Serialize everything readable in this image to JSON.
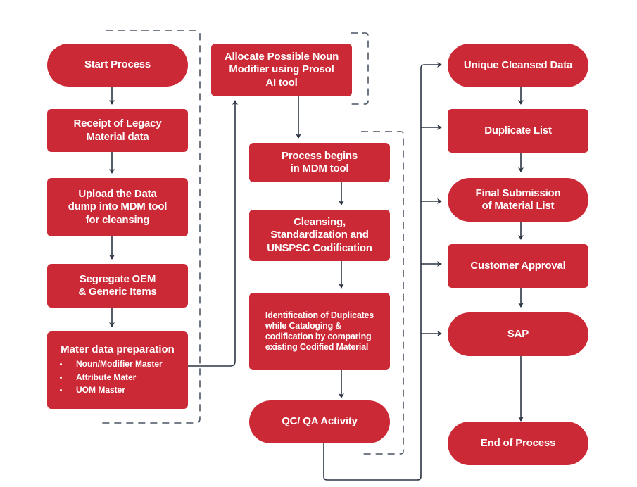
{
  "diagram": {
    "colors": {
      "node_fill": "#CC2936",
      "node_text": "#FFFFFF",
      "connector": "#2B3543",
      "dashed_bracket": "#4A5563"
    },
    "columns": {
      "left": {
        "nodes": [
          {
            "id": "start",
            "shape": "pill",
            "label": "Start Process"
          },
          {
            "id": "receipt",
            "shape": "rect",
            "label": "Receipt of Legacy\nMaterial  data"
          },
          {
            "id": "upload",
            "shape": "rect",
            "label": "Upload the Data\ndump into  MDM tool\nfor cleansing"
          },
          {
            "id": "segregate",
            "shape": "rect",
            "label": "Segregate OEM\n& Generic  Items"
          },
          {
            "id": "prep",
            "shape": "rect",
            "label": "Mater data preparation",
            "bullets": [
              "Noun/Modifier Master",
              "Attribute Mater",
              "UOM Master"
            ]
          }
        ]
      },
      "middle": {
        "nodes": [
          {
            "id": "allocate",
            "shape": "rect",
            "label": "Allocate Possible Noun\nModifier using Prosol\nAI tool"
          },
          {
            "id": "process_begins",
            "shape": "rect",
            "label": "Process begins\nin MDM tool"
          },
          {
            "id": "cleansing",
            "shape": "rect",
            "label": "Cleansing,\nStandardization and\nUNSPSC Codification"
          },
          {
            "id": "identification",
            "shape": "rect",
            "label": "Identification of Duplicates\nwhile Cataloging &\ncodification by comparing\nexisting Codified  Material"
          },
          {
            "id": "qcqa",
            "shape": "pill",
            "label": "QC/ QA Activity"
          }
        ]
      },
      "right": {
        "nodes": [
          {
            "id": "unique",
            "shape": "pill",
            "label": "Unique Cleansed Data"
          },
          {
            "id": "duplicate",
            "shape": "rect",
            "label": "Duplicate List"
          },
          {
            "id": "final",
            "shape": "pill",
            "label": "Final Submission\nof  Material List"
          },
          {
            "id": "approval",
            "shape": "rect",
            "label": "Customer Approval"
          },
          {
            "id": "sap",
            "shape": "pill",
            "label": "SAP"
          },
          {
            "id": "end",
            "shape": "pill",
            "label": "End of Process"
          }
        ]
      }
    },
    "edges": [
      {
        "from": "start",
        "to": "receipt"
      },
      {
        "from": "receipt",
        "to": "upload"
      },
      {
        "from": "upload",
        "to": "segregate"
      },
      {
        "from": "segregate",
        "to": "prep"
      },
      {
        "from": "prep",
        "to": "allocate"
      },
      {
        "from": "allocate",
        "to": "process_begins"
      },
      {
        "from": "process_begins",
        "to": "cleansing"
      },
      {
        "from": "cleansing",
        "to": "identification"
      },
      {
        "from": "identification",
        "to": "qcqa"
      },
      {
        "from": "qcqa",
        "to": "unique"
      },
      {
        "from": "qcqa",
        "to": "duplicate"
      },
      {
        "from": "qcqa",
        "to": "final"
      },
      {
        "from": "qcqa",
        "to": "approval"
      },
      {
        "from": "qcqa",
        "to": "sap"
      },
      {
        "from": "unique",
        "to": "duplicate"
      },
      {
        "from": "duplicate",
        "to": "final"
      },
      {
        "from": "final",
        "to": "approval"
      },
      {
        "from": "approval",
        "to": "sap"
      },
      {
        "from": "sap",
        "to": "end"
      }
    ]
  }
}
